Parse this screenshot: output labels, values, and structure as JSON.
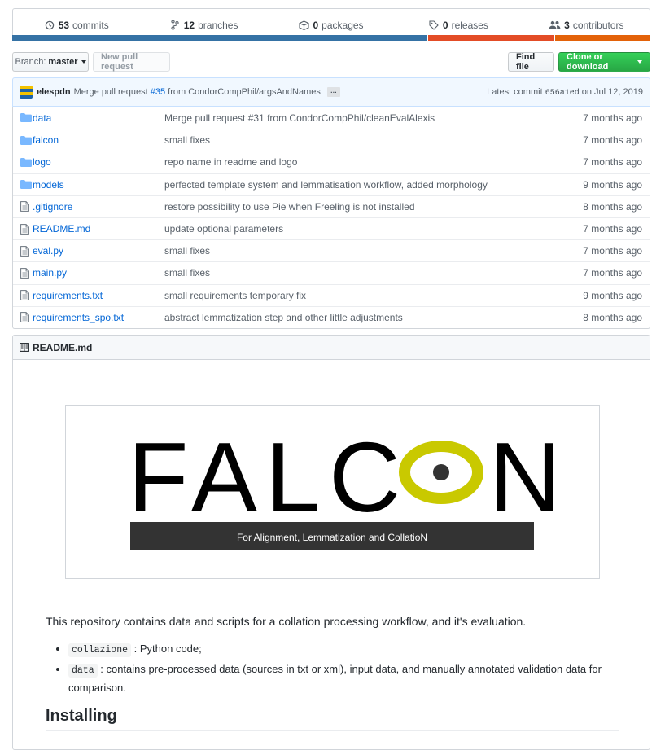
{
  "summary": {
    "commits": {
      "count": "53",
      "label": "commits"
    },
    "branches": {
      "count": "12",
      "label": "branches"
    },
    "packages": {
      "count": "0",
      "label": "packages"
    },
    "releases": {
      "count": "0",
      "label": "releases"
    },
    "contributors": {
      "count": "3",
      "label": "contributors"
    }
  },
  "language_bar": [
    {
      "color": "#3572A5",
      "share": 65
    },
    {
      "color": "#e34c26",
      "share": 20
    },
    {
      "color": "#e36209",
      "share": 15
    }
  ],
  "toolbar": {
    "branch_prefix": "Branch:",
    "branch_name": "master",
    "new_pr": "New pull request",
    "find_file": "Find file",
    "clone": "Clone or download"
  },
  "latest_commit": {
    "author": "elespdn",
    "message_pre": "Merge pull request",
    "pr": "#35",
    "message_post": "from CondorCompPhil/argsAndNames",
    "ellipsis": "…",
    "label": "Latest commit",
    "sha": "656a1ed",
    "date": "on Jul 12, 2019"
  },
  "files": [
    {
      "type": "dir",
      "name": "data",
      "message": "Merge pull request #31 from CondorCompPhil/cleanEvalAlexis",
      "age": "7 months ago"
    },
    {
      "type": "dir",
      "name": "falcon",
      "message": "small fixes",
      "age": "7 months ago"
    },
    {
      "type": "dir",
      "name": "logo",
      "message": "repo name in readme and logo",
      "age": "7 months ago"
    },
    {
      "type": "dir",
      "name": "models",
      "message": "perfected template system and lemmatisation workflow, added morphology",
      "age": "9 months ago"
    },
    {
      "type": "file",
      "name": ".gitignore",
      "message": "restore possibility to use Pie when Freeling is not installed",
      "age": "8 months ago"
    },
    {
      "type": "file",
      "name": "README.md",
      "message": "update optional parameters",
      "age": "7 months ago"
    },
    {
      "type": "file",
      "name": "eval.py",
      "message": "small fixes",
      "age": "7 months ago"
    },
    {
      "type": "file",
      "name": "main.py",
      "message": "small fixes",
      "age": "7 months ago"
    },
    {
      "type": "file",
      "name": "requirements.txt",
      "message": "small requirements temporary fix",
      "age": "9 months ago"
    },
    {
      "type": "file",
      "name": "requirements_spo.txt",
      "message": "abstract lemmatization step and other little adjustments",
      "age": "8 months ago"
    }
  ],
  "readme": {
    "header": "README.md",
    "logo_title_left": "FALC",
    "logo_title_right": "N",
    "logo_tagline": "For Alignment, Lemmatization and CollatioN",
    "intro": "This repository contains data and scripts for a collation processing workflow, and it's evaluation.",
    "bullets": [
      {
        "code": "collazione",
        "text": ": Python code;"
      },
      {
        "code": "data",
        "text": ": contains pre-processed data (sources in txt or xml), input data, and manually annotated validation data for comparison."
      }
    ],
    "h2": "Installing"
  },
  "colors": {
    "link": "#0366d6",
    "logo_accent": "#c9c900",
    "logo_dark": "#333333"
  }
}
